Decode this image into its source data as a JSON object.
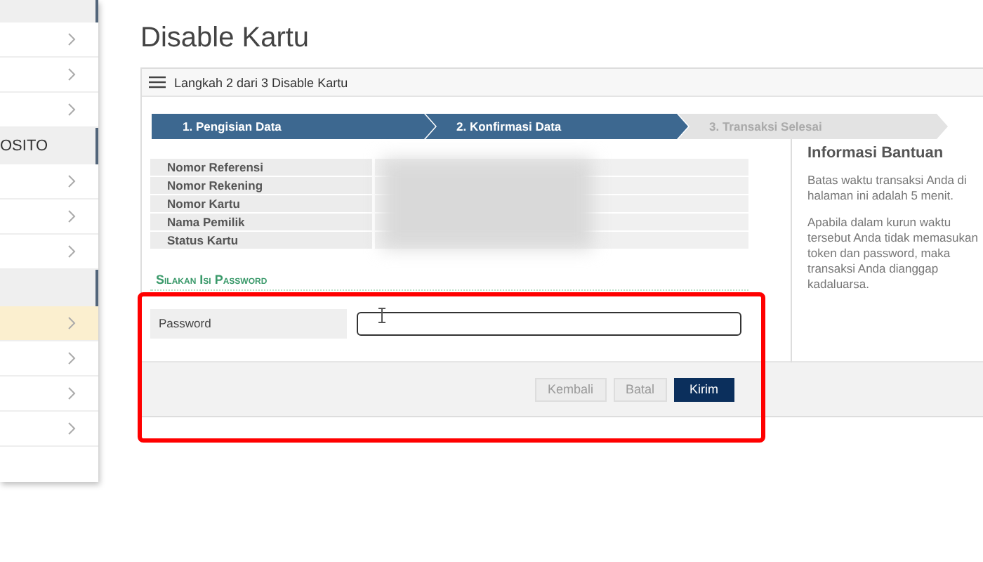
{
  "sidebar": {
    "items": [
      {
        "kind": "header",
        "selected": false
      },
      {
        "kind": "item",
        "selected": false
      },
      {
        "kind": "item",
        "selected": false
      },
      {
        "kind": "item",
        "selected": false
      },
      {
        "kind": "header",
        "label": "OSITO",
        "selected": false
      },
      {
        "kind": "item",
        "selected": false
      },
      {
        "kind": "item",
        "selected": false
      },
      {
        "kind": "item",
        "selected": false
      },
      {
        "kind": "header",
        "selected": false
      },
      {
        "kind": "item",
        "selected": true
      },
      {
        "kind": "item",
        "selected": false
      },
      {
        "kind": "item",
        "selected": false
      },
      {
        "kind": "item",
        "selected": false
      }
    ]
  },
  "page_title": "Disable Kartu",
  "panel": {
    "title": "Langkah 2 dari 3 Disable Kartu",
    "steps": [
      {
        "label": "1. Pengisian Data",
        "active": true
      },
      {
        "label": "2. Konfirmasi Data",
        "active": true
      },
      {
        "label": "3. Transaksi Selesai",
        "active": false
      }
    ],
    "details": [
      "Nomor Referensi",
      "Nomor Rekening",
      "Nomor Kartu",
      "Nama Pemilik",
      "Status Kartu"
    ],
    "section_title": "Silakan Isi Password",
    "password": {
      "label": "Password"
    },
    "help": {
      "title": "Informasi Bantuan",
      "paragraphs": [
        "Batas waktu transaksi Anda di halaman ini adalah 5 menit.",
        "Apabila dalam kurun waktu tersebut Anda tidak memasukan token dan password, maka transaksi Anda dianggap kadaluarsa."
      ]
    },
    "buttons": [
      {
        "label": "Kembali",
        "kind": "secondary"
      },
      {
        "label": "Batal",
        "kind": "secondary"
      },
      {
        "label": "Kirim",
        "kind": "primary"
      }
    ]
  }
}
